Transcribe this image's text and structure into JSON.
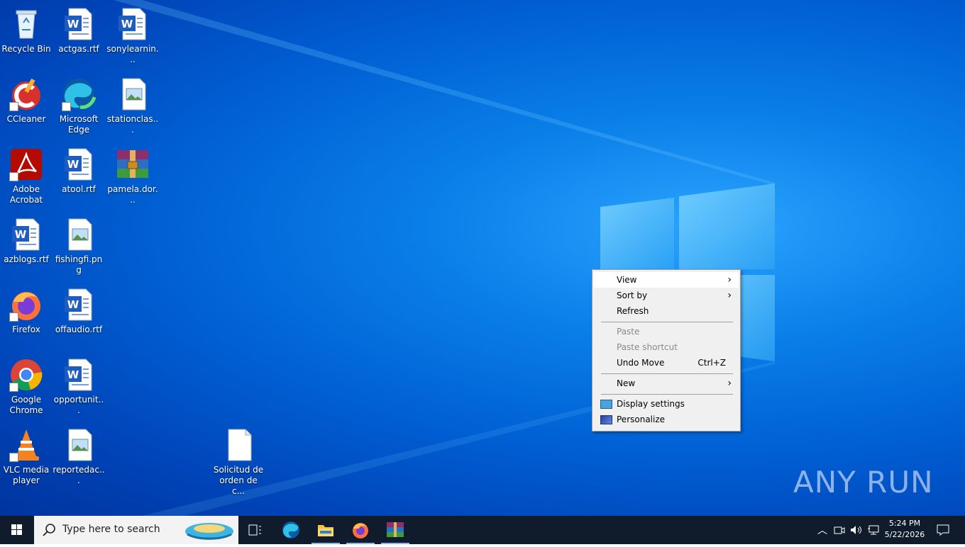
{
  "desktop_icons": [
    {
      "label": "Recycle Bin",
      "icon": "recycle-bin-icon"
    },
    {
      "label": "actgas.rtf",
      "icon": "word-document-icon"
    },
    {
      "label": "sonylearnin...",
      "icon": "word-document-icon"
    },
    {
      "label": "CCleaner",
      "icon": "ccleaner-icon"
    },
    {
      "label": "Microsoft Edge",
      "icon": "edge-icon"
    },
    {
      "label": "stationclas...",
      "icon": "image-file-icon"
    },
    {
      "label": "Adobe Acrobat",
      "icon": "acrobat-icon"
    },
    {
      "label": "atool.rtf",
      "icon": "word-document-icon"
    },
    {
      "label": "pamela.dor...",
      "icon": "winrar-archive-icon"
    },
    {
      "label": "azblogs.rtf",
      "icon": "word-document-icon"
    },
    {
      "label": "fishingfi.png",
      "icon": "image-file-icon"
    },
    {
      "label": "Firefox",
      "icon": "firefox-icon"
    },
    {
      "label": "offaudio.rtf",
      "icon": "word-document-icon"
    },
    {
      "label": "Google Chrome",
      "icon": "chrome-icon"
    },
    {
      "label": "opportunit...",
      "icon": "word-document-icon"
    },
    {
      "label": "VLC media player",
      "icon": "vlc-icon"
    },
    {
      "label": "reportedac...",
      "icon": "image-file-icon"
    },
    {
      "label": "Solicitud de orden de c...",
      "icon": "blank-file-icon"
    }
  ],
  "context_menu": {
    "view": "View",
    "sort_by": "Sort by",
    "refresh": "Refresh",
    "paste": "Paste",
    "paste_shortcut": "Paste shortcut",
    "undo_move": "Undo Move",
    "undo_shortcut": "Ctrl+Z",
    "new": "New",
    "display_settings": "Display settings",
    "personalize": "Personalize"
  },
  "taskbar": {
    "search_placeholder": "Type here to search",
    "time": "5:24 PM",
    "date": "5/22/2026"
  },
  "watermark": "ANY RUN",
  "colors": {
    "desktop_blue": "#0a7fe8",
    "taskbar": "#101b2b",
    "menu_bg": "#f0f0f0"
  }
}
